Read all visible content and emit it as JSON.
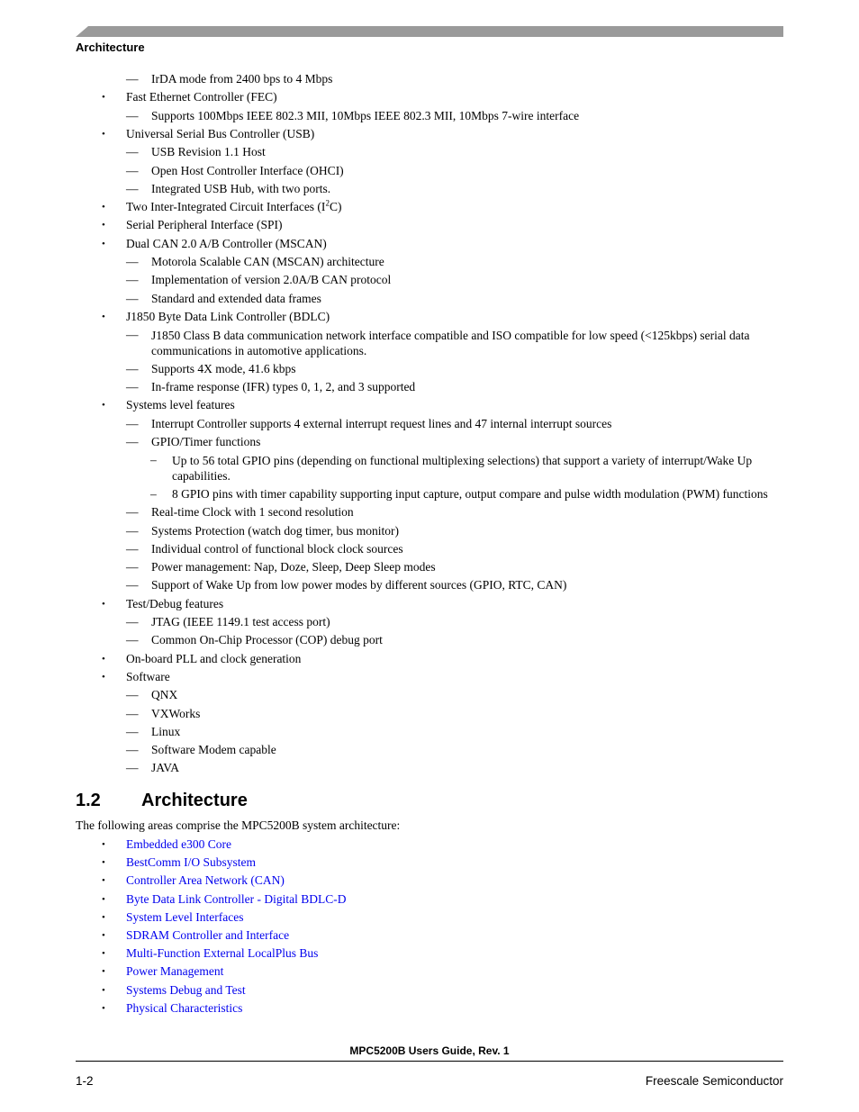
{
  "header": {
    "running_head": "Architecture"
  },
  "features": [
    {
      "level": 2,
      "text": "IrDA mode from 2400 bps to 4 Mbps"
    },
    {
      "level": 1,
      "text": "Fast Ethernet Controller (FEC)"
    },
    {
      "level": 2,
      "text": "Supports 100Mbps IEEE 802.3 MII, 10Mbps IEEE 802.3 MII, 10Mbps 7-wire interface"
    },
    {
      "level": 1,
      "text": "Universal Serial Bus Controller (USB)"
    },
    {
      "level": 2,
      "text": "USB Revision 1.1 Host"
    },
    {
      "level": 2,
      "text": "Open Host Controller Interface (OHCI)"
    },
    {
      "level": 2,
      "text": "Integrated USB Hub, with two ports."
    },
    {
      "level": 1,
      "text": "Two Inter-Integrated Circuit Interfaces (I",
      "sup": "2",
      "after": "C)"
    },
    {
      "level": 1,
      "text": "Serial Peripheral Interface (SPI)"
    },
    {
      "level": 1,
      "text": "Dual CAN 2.0 A/B Controller (MSCAN)"
    },
    {
      "level": 2,
      "text": "Motorola Scalable CAN (MSCAN) architecture"
    },
    {
      "level": 2,
      "text": "Implementation of version 2.0A/B CAN protocol"
    },
    {
      "level": 2,
      "text": "Standard and extended data frames"
    },
    {
      "level": 1,
      "text": "J1850 Byte Data Link Controller (BDLC)"
    },
    {
      "level": 2,
      "text": "J1850 Class B data communication network interface compatible and ISO compatible for low speed (<125kbps) serial data communications in automotive applications.",
      "lines": 2
    },
    {
      "level": 2,
      "text": "Supports 4X mode, 41.6 kbps"
    },
    {
      "level": 2,
      "text": "In-frame response (IFR) types 0, 1, 2, and 3 supported"
    },
    {
      "level": 1,
      "text": "Systems level features"
    },
    {
      "level": 2,
      "text": "Interrupt Controller supports 4 external interrupt request lines and 47 internal interrupt sources"
    },
    {
      "level": 2,
      "text": "GPIO/Timer functions"
    },
    {
      "level": 3,
      "text": "Up to 56 total GPIO pins (depending on functional multiplexing selections) that support a variety of interrupt/Wake Up capabilities.",
      "lines": 2
    },
    {
      "level": 3,
      "text": "8 GPIO pins with timer capability supporting input capture, output compare and pulse width modulation (PWM) functions"
    },
    {
      "level": 2,
      "text": "Real-time Clock with 1 second resolution"
    },
    {
      "level": 2,
      "text": "Systems Protection (watch dog timer, bus monitor)"
    },
    {
      "level": 2,
      "text": "Individual control of functional block clock sources"
    },
    {
      "level": 2,
      "text": "Power management: Nap, Doze, Sleep, Deep Sleep modes"
    },
    {
      "level": 2,
      "text": "Support of Wake Up from low power modes by different sources (GPIO, RTC, CAN)"
    },
    {
      "level": 1,
      "text": "Test/Debug features"
    },
    {
      "level": 2,
      "text": "JTAG (IEEE 1149.1 test access port)"
    },
    {
      "level": 2,
      "text": "Common On-Chip Processor (COP) debug port"
    },
    {
      "level": 1,
      "text": "On-board PLL and clock generation"
    },
    {
      "level": 1,
      "text": "Software"
    },
    {
      "level": 2,
      "text": "QNX"
    },
    {
      "level": 2,
      "text": "VXWorks"
    },
    {
      "level": 2,
      "text": "Linux"
    },
    {
      "level": 2,
      "text": "Software Modem capable"
    },
    {
      "level": 2,
      "text": "JAVA"
    }
  ],
  "markers": {
    "bullet": "•",
    "dash": "—",
    "en_dash": "–"
  },
  "section": {
    "number": "1.2",
    "title": "Architecture",
    "intro": "The following areas comprise the MPC5200B system architecture:",
    "links": [
      "Embedded e300 Core",
      "BestComm I/O Subsystem",
      "Controller Area Network (CAN)",
      "Byte Data Link Controller - Digital BDLC-D",
      "System Level Interfaces",
      "SDRAM Controller and Interface",
      "Multi-Function External LocalPlus Bus",
      "Power Management",
      "Systems Debug and Test",
      "Physical Characteristics"
    ]
  },
  "footer": {
    "title": "MPC5200B Users Guide, Rev. 1",
    "page": "1-2",
    "company": "Freescale Semiconductor"
  },
  "colors": {
    "link": "#0000ee",
    "header_bar": "#9a9a9a"
  }
}
